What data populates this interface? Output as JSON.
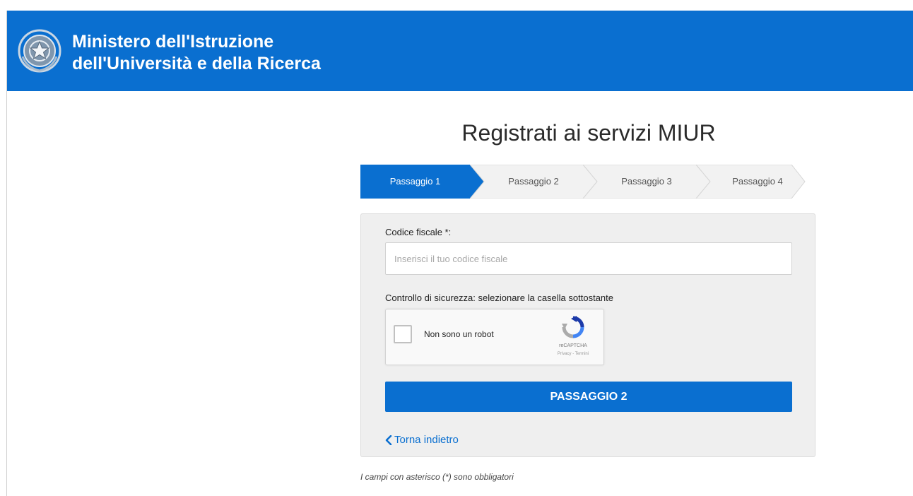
{
  "header": {
    "title_line1": "Ministero dell'Istruzione",
    "title_line2": "dell'Università e della Ricerca",
    "emblem_icon": "italian-republic-emblem-icon"
  },
  "page": {
    "title": "Registrati ai servizi MIUR"
  },
  "stepper": {
    "steps": [
      {
        "label": "Passaggio 1",
        "active": true
      },
      {
        "label": "Passaggio 2",
        "active": false
      },
      {
        "label": "Passaggio 3",
        "active": false
      },
      {
        "label": "Passaggio 4",
        "active": false
      }
    ]
  },
  "form": {
    "codice_fiscale_label": "Codice fiscale *:",
    "codice_fiscale_placeholder": "Inserisci il tuo codice fiscale",
    "codice_fiscale_value": "",
    "security_label": "Controllo di sicurezza: selezionare la casella sottostante",
    "captcha": {
      "checkbox_label": "Non sono un robot",
      "brand": "reCAPTCHA",
      "links": "Privacy - Termini",
      "checked": false
    },
    "submit_label": "PASSAGGIO 2",
    "back_label": "Torna indietro",
    "back_icon": "chevron-left-icon"
  },
  "footer": {
    "required_note": "I campi con asterisco (*) sono obbligatori"
  },
  "colors": {
    "primary": "#0a6fd0",
    "card_background": "#efefef",
    "step_inactive": "#f2f2f2"
  }
}
